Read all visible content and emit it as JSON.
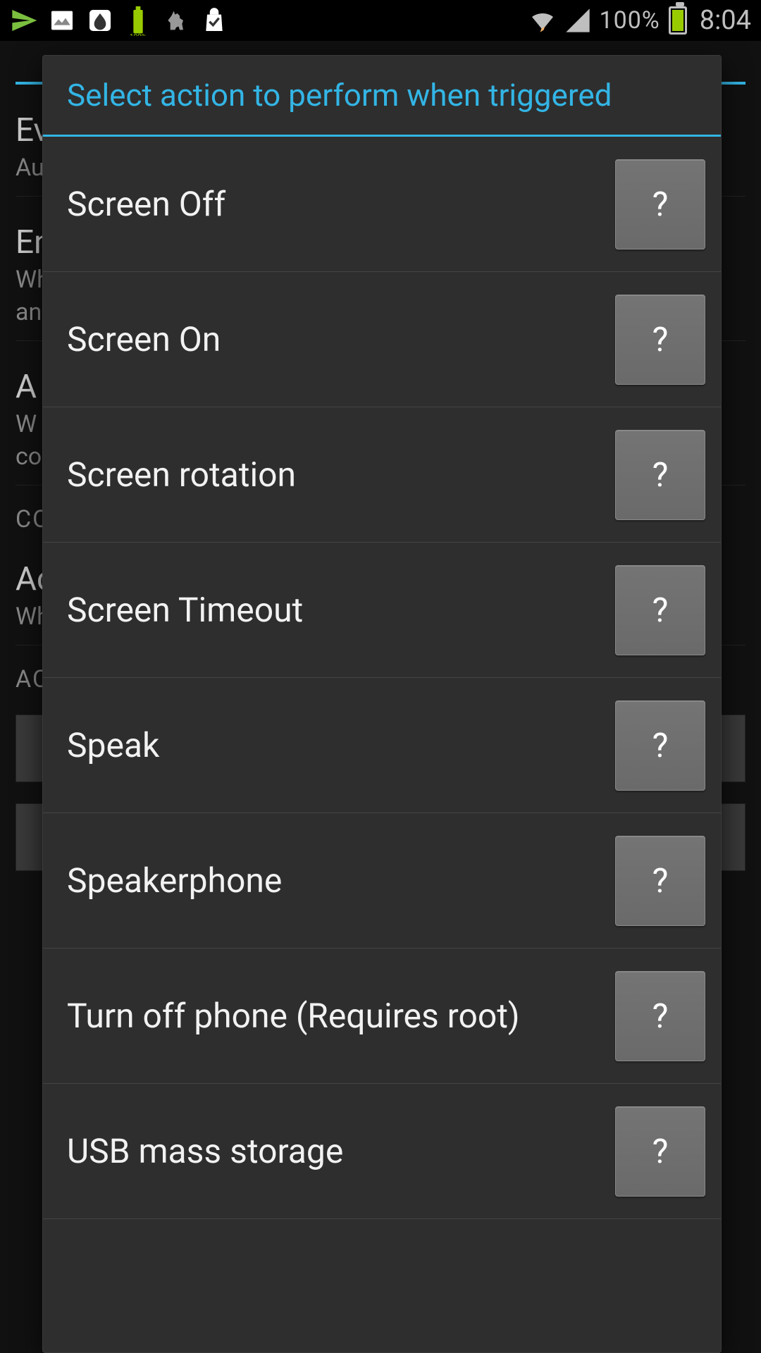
{
  "statusbar": {
    "battery_pct": "100%",
    "time": "8:04"
  },
  "background": {
    "row1_title": "Ev",
    "row1_sub": "Aut",
    "row2_title": "En",
    "row2_sub1": "Wh",
    "row2_sub2": "anc",
    "row3_title": "A",
    "row3_sub1": "W",
    "row3_sub2": "co",
    "section_co": "CO",
    "row4_title": "Ac",
    "row4_sub": "Wh",
    "section_ac": "AC"
  },
  "dialog": {
    "title": "Select action to perform when triggered",
    "help_label": "?",
    "items": [
      {
        "label": "Screen Off"
      },
      {
        "label": "Screen On"
      },
      {
        "label": "Screen rotation"
      },
      {
        "label": "Screen Timeout"
      },
      {
        "label": "Speak"
      },
      {
        "label": "Speakerphone"
      },
      {
        "label": "Turn off phone (Requires root)"
      },
      {
        "label": "USB mass storage"
      }
    ]
  }
}
